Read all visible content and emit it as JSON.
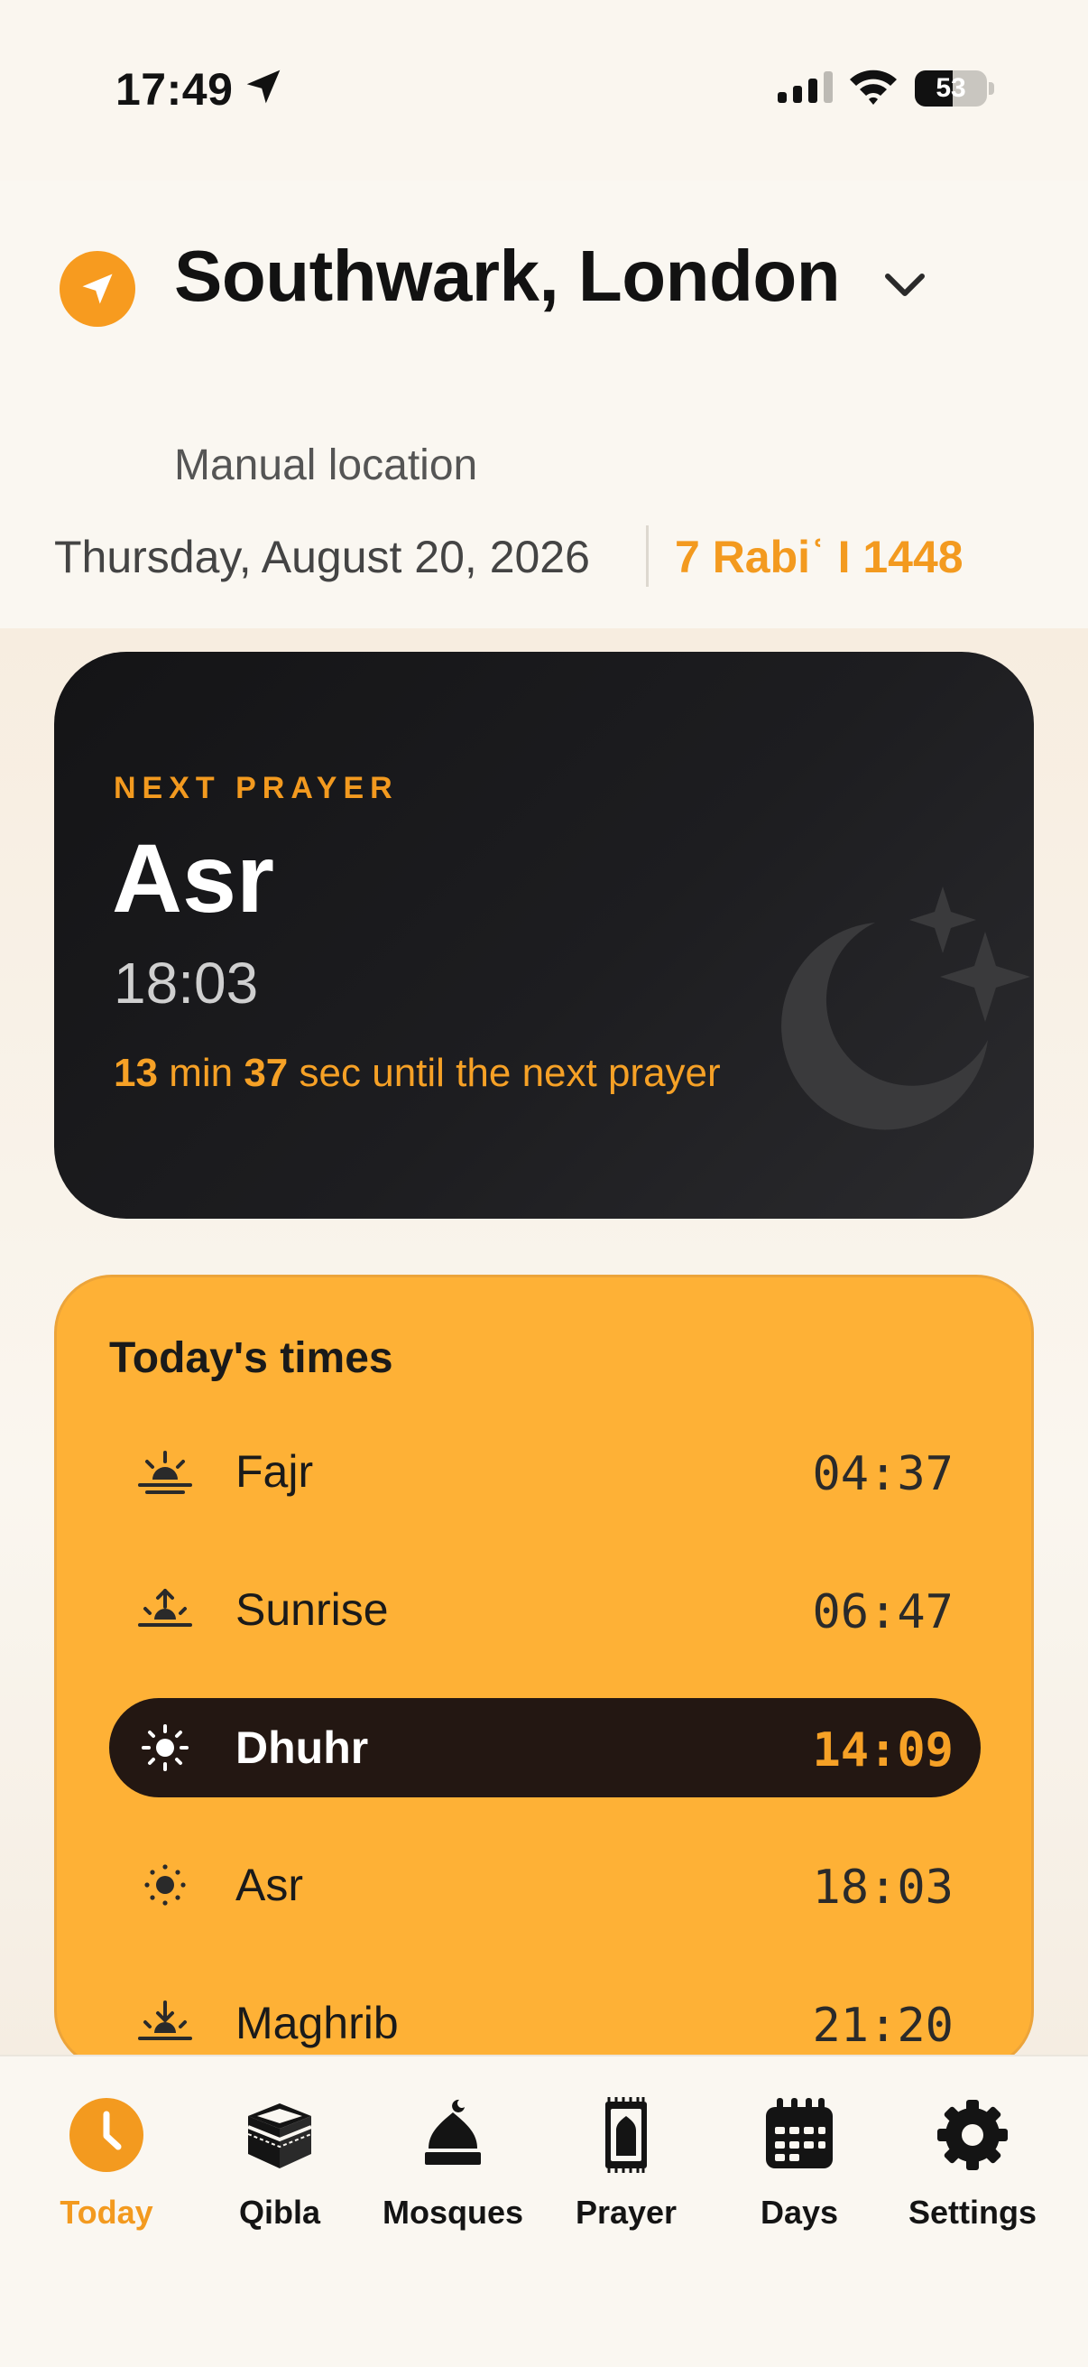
{
  "status_bar": {
    "time": "17:49",
    "battery": "53",
    "battery_level": 0.53
  },
  "header": {
    "location": "Southwark, London",
    "location_mode": "Manual location",
    "gregorian_date": "Thursday, August 20, 2026",
    "hijri_date": "7 Rabiʿ I 1448"
  },
  "next_prayer": {
    "label": "NEXT PRAYER",
    "name": "Asr",
    "time": "18:03",
    "countdown": {
      "minutes": "13",
      "min_unit": "min",
      "seconds": "37",
      "sec_unit": "sec",
      "suffix": "until the next prayer"
    }
  },
  "today": {
    "title": "Today's times",
    "prayers": [
      {
        "name": "Fajr",
        "time": "04:37",
        "icon": "sunrise-dawn-icon",
        "active": false
      },
      {
        "name": "Sunrise",
        "time": "06:47",
        "icon": "sunrise-icon",
        "active": false
      },
      {
        "name": "Dhuhr",
        "time": "14:09",
        "icon": "sun-icon",
        "active": true
      },
      {
        "name": "Asr",
        "time": "18:03",
        "icon": "sun-icon",
        "active": false
      },
      {
        "name": "Maghrib",
        "time": "21:20",
        "icon": "sunset-icon",
        "active": false
      }
    ]
  },
  "tabs": [
    {
      "label": "Today",
      "icon": "clock-icon",
      "active": true
    },
    {
      "label": "Qibla",
      "icon": "kaaba-icon",
      "active": false
    },
    {
      "label": "Mosques",
      "icon": "mosque-icon",
      "active": false
    },
    {
      "label": "Prayer",
      "icon": "prayer-mat-icon",
      "active": false
    },
    {
      "label": "Days",
      "icon": "calendar-icon",
      "active": false
    },
    {
      "label": "Settings",
      "icon": "gear-icon",
      "active": false
    }
  ],
  "colors": {
    "accent": "#f39a1f",
    "card_dark": "#1d1d20",
    "times_card": "#feb136",
    "active_row": "#231712"
  }
}
